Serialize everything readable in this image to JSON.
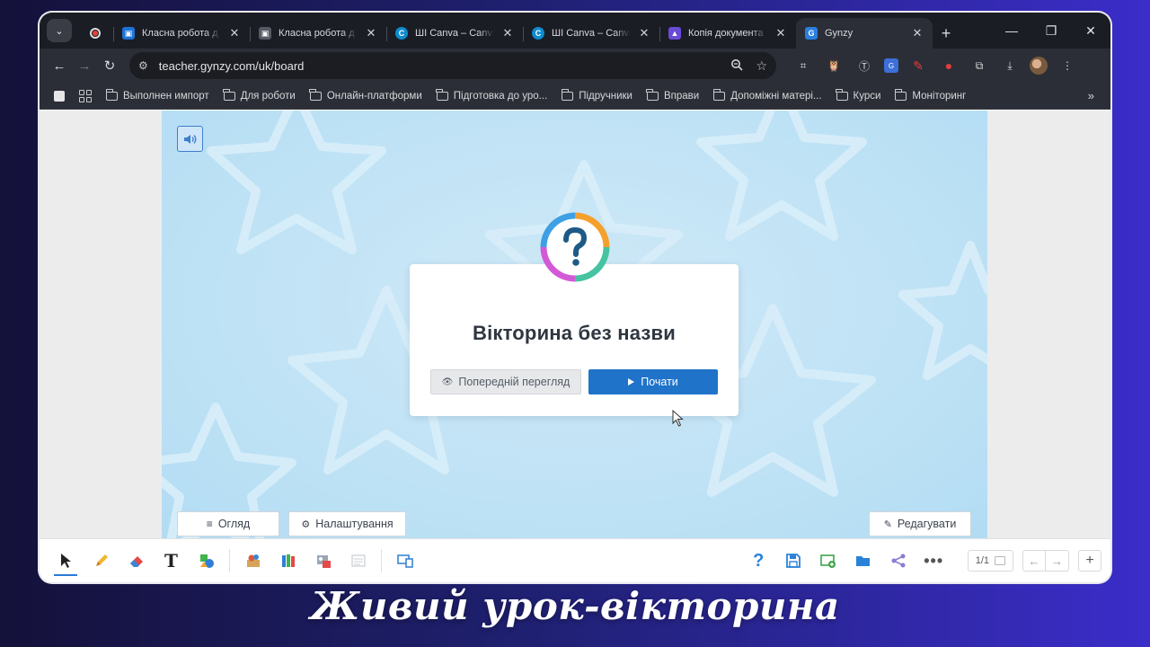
{
  "browser": {
    "tabs": [
      {
        "title": "Класна робота д",
        "favicon": "classroom-icon"
      },
      {
        "title": "Класна робота д",
        "favicon": "slides-icon"
      },
      {
        "title": "ШІ Canva – Canva",
        "favicon": "canva-icon"
      },
      {
        "title": "ШІ Canva – Canva",
        "favicon": "canva-icon"
      },
      {
        "title": "Копія документа",
        "favicon": "docs-icon"
      },
      {
        "title": "Gynzy",
        "favicon": "gynzy-icon",
        "active": true
      }
    ],
    "new_tab": "+",
    "url": "teacher.gynzy.com/uk/board",
    "bookmarks": [
      "Выполнен импорт",
      "Для роботи",
      "Онлайн-платформи",
      "Підготовка до уро...",
      "Підручники",
      "Вправи",
      "Допоміжні матері...",
      "Курси",
      "Моніторинг"
    ],
    "bookmarks_more": "»"
  },
  "quiz": {
    "title": "Вікторина без назви",
    "preview_label": "Попередній перегляд",
    "start_label": "Почати"
  },
  "board_buttons": {
    "overview_label": "Огляд",
    "settings_label": "Налаштування",
    "edit_label": "Редагувати"
  },
  "toolbar": {
    "page_indicator": "1/1"
  },
  "caption": "Живий урок-вікторина",
  "colors": {
    "accent_blue": "#1f73c9",
    "board_bg": "#bfe2f5",
    "chrome_dark": "#1b1d24"
  }
}
